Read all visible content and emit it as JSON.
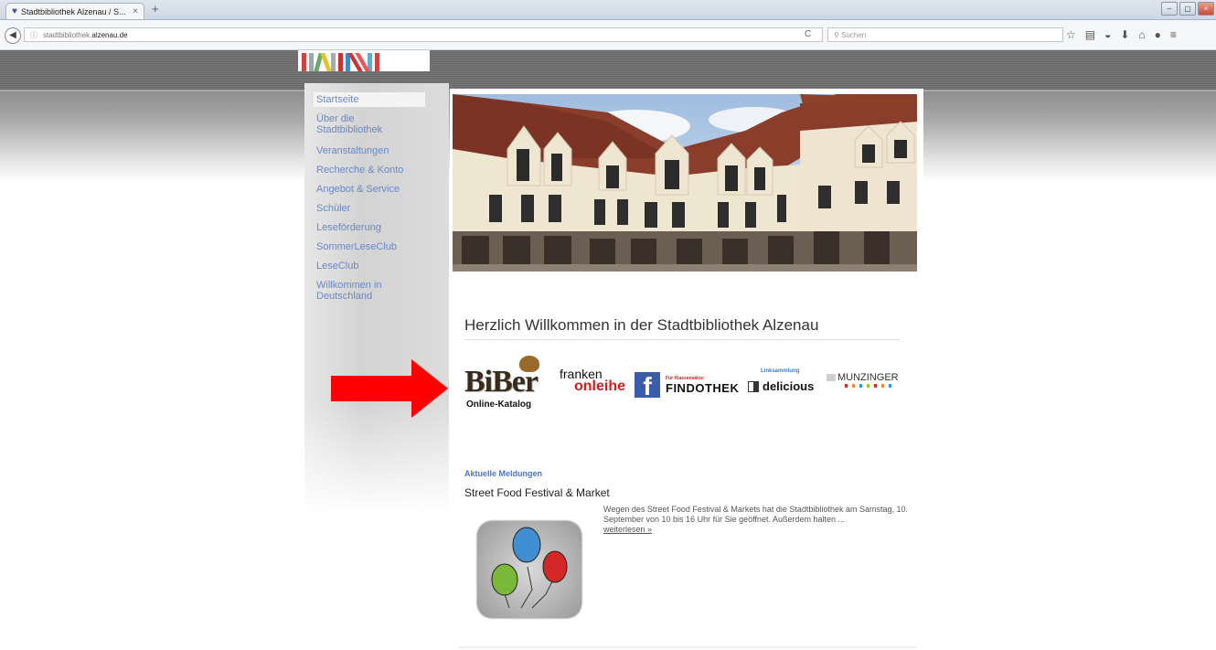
{
  "browser": {
    "tab_title": "Stadtbibliothek Alzenau / S...",
    "tab_close": "×",
    "new_tab": "+",
    "url_prefix": "stadtbibliothek.",
    "url_domain": "alzenau.de",
    "reload": "C",
    "search_placeholder": "Suchen",
    "window_buttons": [
      "–",
      "▢",
      "×"
    ]
  },
  "nav": {
    "items": [
      {
        "label": "Startseite",
        "active": true
      },
      {
        "label": "Über die Stadtbibliothek",
        "active": false
      },
      {
        "label": "Veranstaltungen",
        "active": false
      },
      {
        "label": "Recherche & Konto",
        "active": false
      },
      {
        "label": "Angebot & Service",
        "active": false
      },
      {
        "label": "Schüler",
        "active": false
      },
      {
        "label": "Leseförderung",
        "active": false
      },
      {
        "label": "SommerLeseClub",
        "active": false
      },
      {
        "label": "LeseClub",
        "active": false
      },
      {
        "label": "Willkommen in Deutschland",
        "active": false
      }
    ]
  },
  "main": {
    "heading": "Herzlich Willkommen in der Stadtbibliothek Alzenau",
    "logos": {
      "biber": "BiBer",
      "biber_caption": "Online-Katalog",
      "franken": "franken",
      "onleihe": "onleihe",
      "facebook": "f",
      "findothek_top": "Für Klassensätze:",
      "findothek": "FINDOTHEK",
      "delicious_top": "Linksammlung",
      "delicious": "delicious",
      "munzinger": "MUNZINGER"
    },
    "news_section": "Aktuelle Meldungen",
    "news_title": "Street Food Festival & Market",
    "news_text": "Wegen des Street Food Festival & Markets hat die Stadtbibliothek am Samstag, 10. September von 10 bis 16 Uhr für Sie geöffnet. Außerdem halten ...",
    "news_more": "weiterlesen »"
  },
  "colors": {
    "nav_link": "#6a88c4",
    "section_blue": "#4d74b8",
    "arrow_red": "#ff0000",
    "roof": "#8a3d2a",
    "facade": "#efe6d2"
  }
}
